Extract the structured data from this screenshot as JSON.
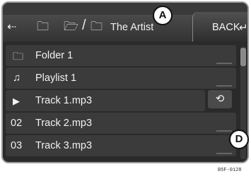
{
  "header": {
    "path_label": "The Artist",
    "back_label": "BACK",
    "icons": [
      "usb-icon",
      "folder-icon",
      "folder-open-icon",
      "folder-icon"
    ]
  },
  "callouts": {
    "a": "A",
    "d": "D"
  },
  "list": {
    "items": [
      {
        "icon": "folder-icon",
        "number": "",
        "label": "Folder 1"
      },
      {
        "icon": "playlist-icon",
        "number": "",
        "label": "Playlist 1"
      },
      {
        "icon": "play-icon",
        "number": "",
        "label": "Track 1.mp3"
      },
      {
        "icon": "",
        "number": "02",
        "label": "Track 2.mp3"
      },
      {
        "icon": "",
        "number": "03",
        "label": "Track 3.mp3"
      }
    ]
  },
  "figure_code": "B5F-0128",
  "colors": {
    "background": "#2a2a2a",
    "row": "#3b3b3b",
    "text": "#f2f2f2"
  }
}
